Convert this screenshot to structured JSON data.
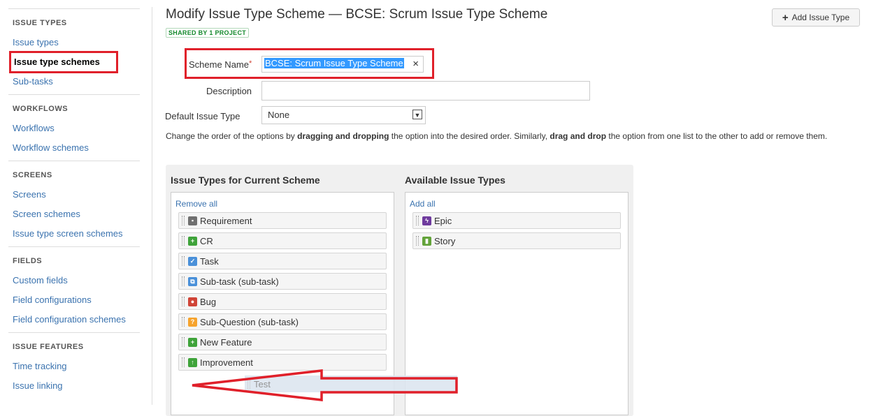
{
  "sidebar": {
    "sections": [
      {
        "header": "ISSUE TYPES",
        "items": [
          "Issue types",
          "Issue type schemes",
          "Sub-tasks"
        ]
      },
      {
        "header": "WORKFLOWS",
        "items": [
          "Workflows",
          "Workflow schemes"
        ]
      },
      {
        "header": "SCREENS",
        "items": [
          "Screens",
          "Screen schemes",
          "Issue type screen schemes"
        ]
      },
      {
        "header": "FIELDS",
        "items": [
          "Custom fields",
          "Field configurations",
          "Field configuration schemes"
        ]
      },
      {
        "header": "ISSUE FEATURES",
        "items": [
          "Time tracking",
          "Issue linking"
        ]
      }
    ],
    "active_item": "Issue type schemes"
  },
  "header": {
    "title": "Modify Issue Type Scheme — BCSE: Scrum Issue Type Scheme",
    "badge": "SHARED BY 1 PROJECT",
    "add_button": "Add Issue Type"
  },
  "form": {
    "scheme_name_label": "Scheme Name",
    "scheme_name_value": "BCSE: Scrum Issue Type Scheme",
    "description_label": "Description",
    "description_value": "",
    "default_type_label": "Default Issue Type",
    "default_type_value": "None"
  },
  "help": {
    "p1": "Change the order of the options by ",
    "b1": "dragging and dropping",
    "p2": " the option into the desired order. Similarly, ",
    "b2": "drag and drop",
    "p3": " the option from one list to the other to add or remove them."
  },
  "current": {
    "title": "Issue Types for Current Scheme",
    "action": "Remove all",
    "items": [
      {
        "label": "Requirement",
        "icon": "requirement-icon",
        "color": "#707070",
        "glyph": "▪"
      },
      {
        "label": "CR",
        "icon": "plus-icon",
        "color": "#3fa33a",
        "glyph": "+"
      },
      {
        "label": "Task",
        "icon": "checkbox-icon",
        "color": "#4a90d9",
        "glyph": "✓"
      },
      {
        "label": "Sub-task (sub-task)",
        "icon": "subtask-icon",
        "color": "#4a90d9",
        "glyph": "⧉"
      },
      {
        "label": "Bug",
        "icon": "bug-icon",
        "color": "#d04437",
        "glyph": "●"
      },
      {
        "label": "Sub-Question (sub-task)",
        "icon": "question-icon",
        "color": "#f6a32d",
        "glyph": "?"
      },
      {
        "label": "New Feature",
        "icon": "plus-icon",
        "color": "#3fa33a",
        "glyph": "+"
      },
      {
        "label": "Improvement",
        "icon": "arrow-up-icon",
        "color": "#3fa33a",
        "glyph": "↑"
      }
    ]
  },
  "available": {
    "title": "Available Issue Types",
    "action": "Add all",
    "items": [
      {
        "label": "Epic",
        "icon": "epic-icon",
        "color": "#6f3b9e",
        "glyph": "ϟ"
      },
      {
        "label": "Story",
        "icon": "story-icon",
        "color": "#63a33a",
        "glyph": "▮"
      }
    ]
  },
  "dragging": {
    "label": "Test"
  }
}
